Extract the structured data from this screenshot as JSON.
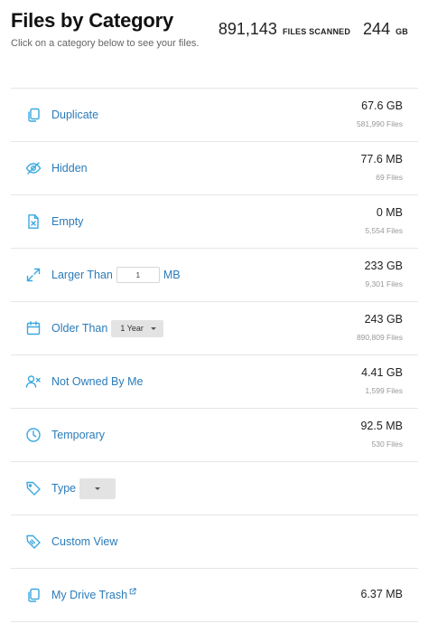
{
  "header": {
    "title": "Files by Category",
    "subtitle": "Click on a category below to see your files.",
    "files_scanned_value": "891,143",
    "files_scanned_label": "FILES SCANNED",
    "storage_value": "244",
    "storage_unit": "GB"
  },
  "categories": [
    {
      "label": "Duplicate",
      "size": "67.6 GB",
      "count": "581,990 Files",
      "icon": "copy-icon"
    },
    {
      "label": "Hidden",
      "size": "77.6 MB",
      "count": "69 Files",
      "icon": "eye-off-icon"
    },
    {
      "label": "Empty",
      "size": "0 MB",
      "count": "5,554 Files",
      "icon": "empty-file-icon"
    },
    {
      "label": "Larger Than",
      "input_value": "1",
      "unit": "MB",
      "size": "233 GB",
      "count": "9,301 Files",
      "icon": "expand-icon"
    },
    {
      "label": "Older Than",
      "dropdown_value": "1 Year",
      "size": "243 GB",
      "count": "890,809 Files",
      "icon": "calendar-icon"
    },
    {
      "label": "Not Owned By Me",
      "size": "4.41 GB",
      "count": "1,599 Files",
      "icon": "user-x-icon"
    },
    {
      "label": "Temporary",
      "size": "92.5 MB",
      "count": "530 Files",
      "icon": "clock-icon"
    },
    {
      "label": "Type",
      "dropdown_value": "",
      "icon": "tag-icon"
    },
    {
      "label": "Custom View",
      "icon": "custom-tag-icon"
    },
    {
      "label": "My Drive Trash",
      "size": "6.37 MB",
      "icon": "trash-copy-icon"
    }
  ],
  "colors": {
    "accent": "#2b7bb9",
    "icon": "#3aa9df",
    "divider": "#e6e6e6"
  }
}
